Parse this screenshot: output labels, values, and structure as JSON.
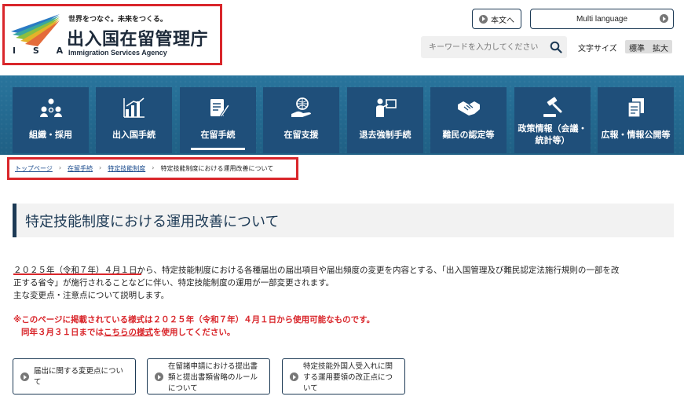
{
  "header": {
    "tagline": "世界をつなぐ。未来をつくる。",
    "title": "出入国在留管理庁",
    "subtitle_en": "Immigration Services Agency",
    "isa": "I S A",
    "skip_label": "本文へ",
    "language_label": "Multi language",
    "search_placeholder": "キーワードを入力してください",
    "font_size_label": "文字サイズ",
    "font_standard": "標準",
    "font_large": "拡大"
  },
  "nav": [
    {
      "label": "組織・採用",
      "icon": "people-org-icon"
    },
    {
      "label": "出入国手続",
      "icon": "bar-chart-icon"
    },
    {
      "label": "在留手続",
      "icon": "document-pen-icon",
      "active": true
    },
    {
      "label": "在留支援",
      "icon": "hand-globe-icon"
    },
    {
      "label": "退去強制手続",
      "icon": "presenter-icon"
    },
    {
      "label": "難民の認定等",
      "icon": "handshake-icon"
    },
    {
      "label": "政策情報（会議・統計等）",
      "icon": "gavel-icon"
    },
    {
      "label": "広報・情報公開等",
      "icon": "documents-icon"
    }
  ],
  "breadcrumb": {
    "home": "トップページ",
    "level1": "在留手続",
    "level2": "特定技能制度",
    "current": "特定技能制度における運用改善について"
  },
  "page": {
    "title": "特定技能制度における運用改善について",
    "body_line1": "２０２５年（令和７年）４月１日から、特定技能制度における各種届出の届出項目や届出頻度の変更を内容とする、「出入国管理及び難民認定法施行規則の一部を改",
    "body_line2": "正する省令」が施行されることなどに伴い、特定技能制度の運用が一部変更されます。",
    "body_line3": "主な変更点・注意点について説明します。",
    "notice_line1": "※このページに掲載されている様式は２０２５年（令和７年）４月１日から使用可能なものです。",
    "notice_line2_pre": "同年３月３１日までは",
    "notice_line2_link": "こちらの様式",
    "notice_line2_post": "を使用してください。"
  },
  "links": [
    {
      "label": "届出に関する変更点について"
    },
    {
      "label": "在留諸申請における提出書類と提出書類省略のルールについて"
    },
    {
      "label": "特定技能外国人受入れに関する運用要領の改正点について"
    }
  ],
  "colors": {
    "accent_red": "#d9262b",
    "navy": "#1d3a55",
    "nav_tile": "#1f4f7a",
    "band": "#2a6f97"
  }
}
